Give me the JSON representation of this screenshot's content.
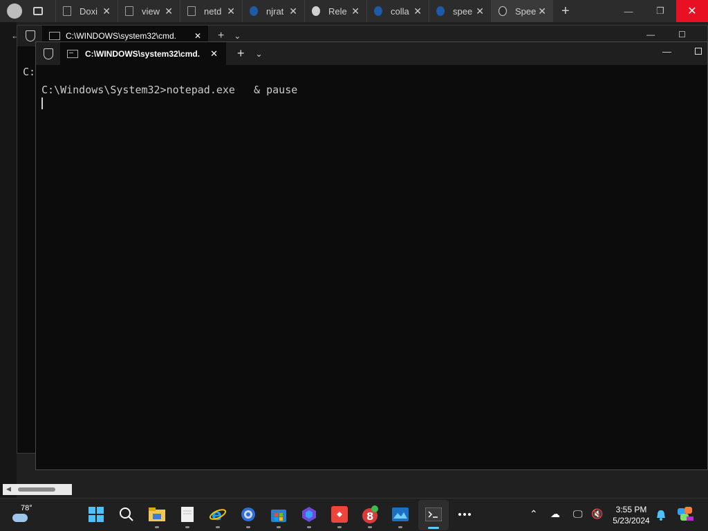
{
  "browser": {
    "tabs": [
      {
        "title": "Doxi",
        "icon": "page-icon"
      },
      {
        "title": "view",
        "icon": "page-icon"
      },
      {
        "title": "netd",
        "icon": "page-icon"
      },
      {
        "title": "njrat",
        "icon": "search-icon"
      },
      {
        "title": "Rele",
        "icon": "github-icon"
      },
      {
        "title": "colla",
        "icon": "search-icon"
      },
      {
        "title": "spee",
        "icon": "search-icon"
      },
      {
        "title": "Spee",
        "icon": "github-copilot-icon",
        "active": true
      }
    ],
    "new_tab": "+",
    "close": "✕"
  },
  "back_terminal": {
    "tab_title": "C:\\WINDOWS\\system32\\cmd.",
    "prompt_fragment": "C:"
  },
  "terminal": {
    "tab_title": "C:\\WINDOWS\\system32\\cmd.",
    "close_tab": "✕",
    "new_tab": "+",
    "dropdown": "⌄",
    "minimize": "—",
    "lines": [
      "C:\\Windows\\System32>notepad.exe   & pause"
    ]
  },
  "taskbar": {
    "weather_temp": "78°",
    "apps": [
      "windows-start-icon",
      "search-icon",
      "file-explorer-icon",
      "notepad-icon",
      "internet-explorer-icon",
      "settings-icon",
      "microsoft-store-icon",
      "visual-studio-icon",
      "anydesk-icon",
      "app-8-icon",
      "photos-icon",
      "terminal-icon",
      "more-icon"
    ],
    "clock_time": "3:55 PM",
    "clock_date": "5/23/2024"
  }
}
